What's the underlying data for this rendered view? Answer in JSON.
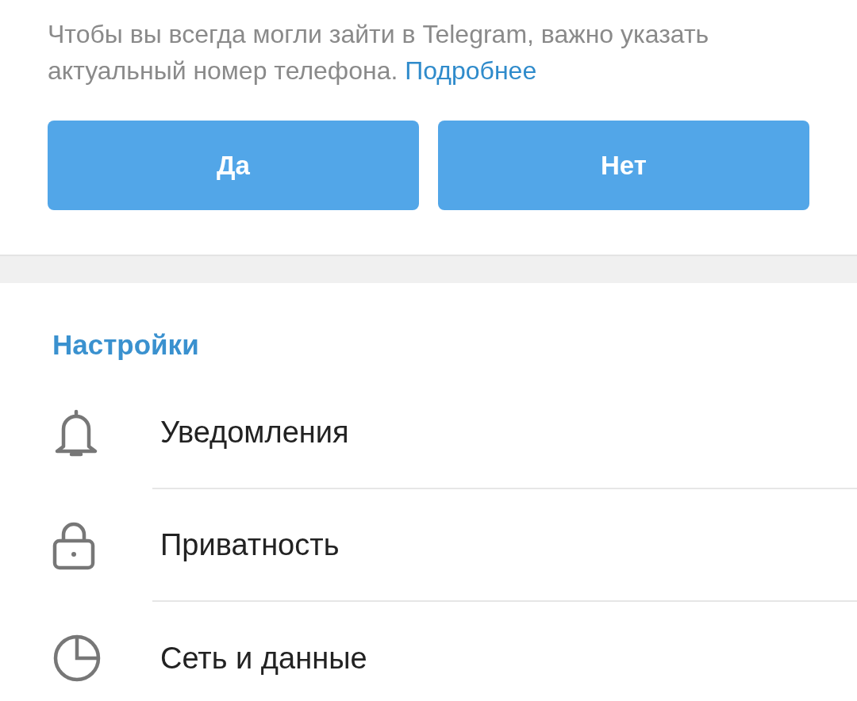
{
  "notice": {
    "text": "Чтобы вы всегда могли зайти в Telegram, важно указать актуальный номер телефона.",
    "link": "Подробнее"
  },
  "buttons": [
    "Да",
    "Нет"
  ],
  "settings": {
    "title": "Настройки",
    "items": [
      {
        "kind": "bell",
        "label": "Уведомления"
      },
      {
        "kind": "lock",
        "label": "Приватность"
      },
      {
        "kind": "pie",
        "label": "Сеть и данные"
      }
    ]
  }
}
